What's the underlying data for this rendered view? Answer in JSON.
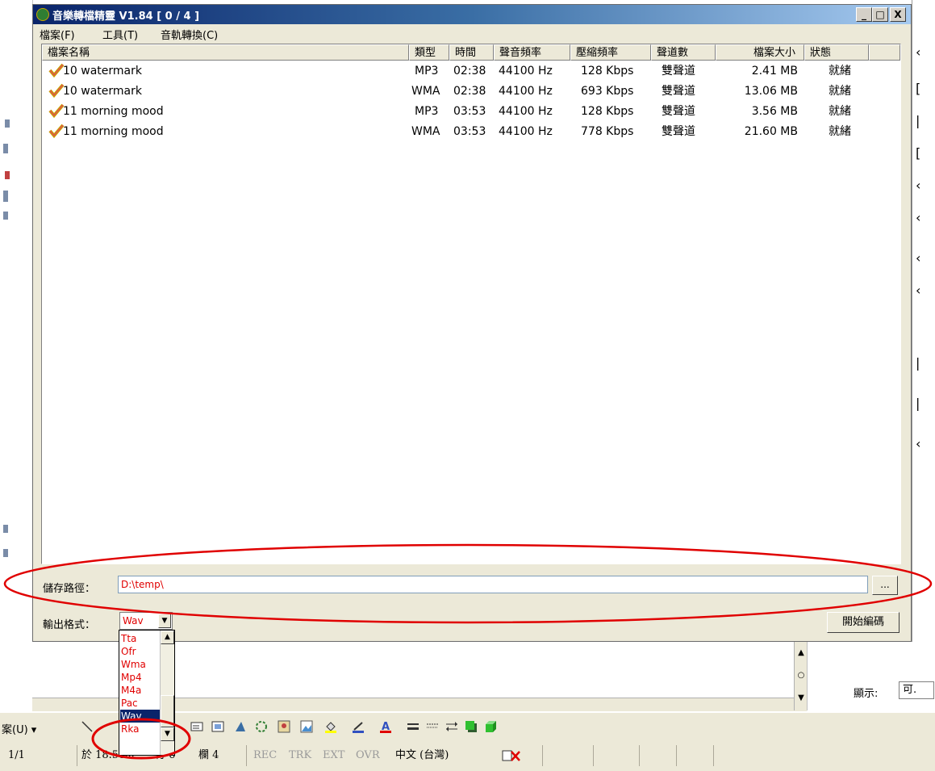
{
  "window": {
    "title": "音樂轉檔精靈 V1.84 [ 0 / 4 ]",
    "minimize_label": "_",
    "maximize_label": "□",
    "close_label": "X"
  },
  "menu": [
    {
      "label": "檔案(F)"
    },
    {
      "label": "工具(T)"
    },
    {
      "label": "音軌轉換(C)"
    }
  ],
  "columns": {
    "name": "檔案名稱",
    "type": "類型",
    "time": "時間",
    "sample_rate": "聲音頻率",
    "bitrate": "壓縮頻率",
    "channels": "聲道數",
    "size": "檔案大小",
    "status": "狀態"
  },
  "files": [
    {
      "name": "10 watermark",
      "type": "MP3",
      "time": "02:38",
      "sample_rate": "44100 Hz",
      "bitrate": "128 Kbps",
      "channels": "雙聲道",
      "size": "2.41 MB",
      "status": "就緒"
    },
    {
      "name": "10 watermark",
      "type": "WMA",
      "time": "02:38",
      "sample_rate": "44100 Hz",
      "bitrate": "693 Kbps",
      "channels": "雙聲道",
      "size": "13.06 MB",
      "status": "就緒"
    },
    {
      "name": "11 morning mood",
      "type": "MP3",
      "time": "03:53",
      "sample_rate": "44100 Hz",
      "bitrate": "128 Kbps",
      "channels": "雙聲道",
      "size": "3.56 MB",
      "status": "就緒"
    },
    {
      "name": "11 morning mood",
      "type": "WMA",
      "time": "03:53",
      "sample_rate": "44100 Hz",
      "bitrate": "778 Kbps",
      "channels": "雙聲道",
      "size": "21.60 MB",
      "status": "就緒"
    }
  ],
  "save_path": {
    "label": "儲存路徑：",
    "value": "D:\\temp\\",
    "browse_label": "..."
  },
  "output_format": {
    "label": "輸出格式：",
    "value": "Wav",
    "options": [
      "Tta",
      "Ofr",
      "Wma",
      "Mp4",
      "M4a",
      "Pac",
      "Wav",
      "Rka"
    ]
  },
  "start_button": "開始編碼",
  "background": {
    "show_label": "顯示:",
    "show_value": "可.",
    "toolbar_menu": "案(U) ▾",
    "status": {
      "page": "1/1",
      "position": "於 18.5cm",
      "line": "行 6",
      "column": "欄 4",
      "rec": "REC",
      "trk": "TRK",
      "ext": "EXT",
      "ovr": "OVR",
      "language": "中文 (台灣)"
    }
  },
  "colors": {
    "annotation": "#e00000",
    "title_start": "#0a246a",
    "title_end": "#a6caf0",
    "selected_option": "#0a246a"
  }
}
